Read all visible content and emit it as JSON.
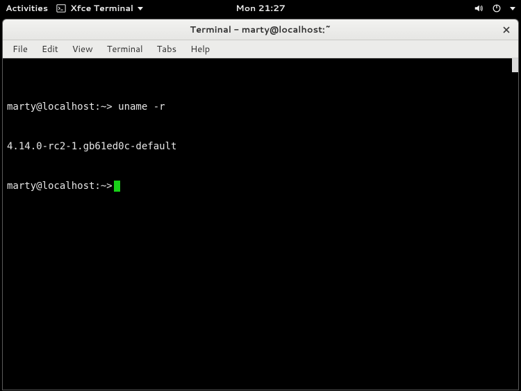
{
  "topbar": {
    "activities": "Activities",
    "app_name": "Xfce Terminal",
    "clock": "Mon 21:27"
  },
  "window": {
    "title": "Terminal - marty@localhost:~"
  },
  "menubar": {
    "items": [
      "File",
      "Edit",
      "View",
      "Terminal",
      "Tabs",
      "Help"
    ]
  },
  "terminal": {
    "lines": [
      {
        "prompt": "marty@localhost:~>",
        "text": " uname -r"
      },
      {
        "prompt": "",
        "text": "4.14.0-rc2-1.gb61ed0c-default"
      },
      {
        "prompt": "marty@localhost:~>",
        "text": "",
        "cursor": true
      }
    ]
  }
}
